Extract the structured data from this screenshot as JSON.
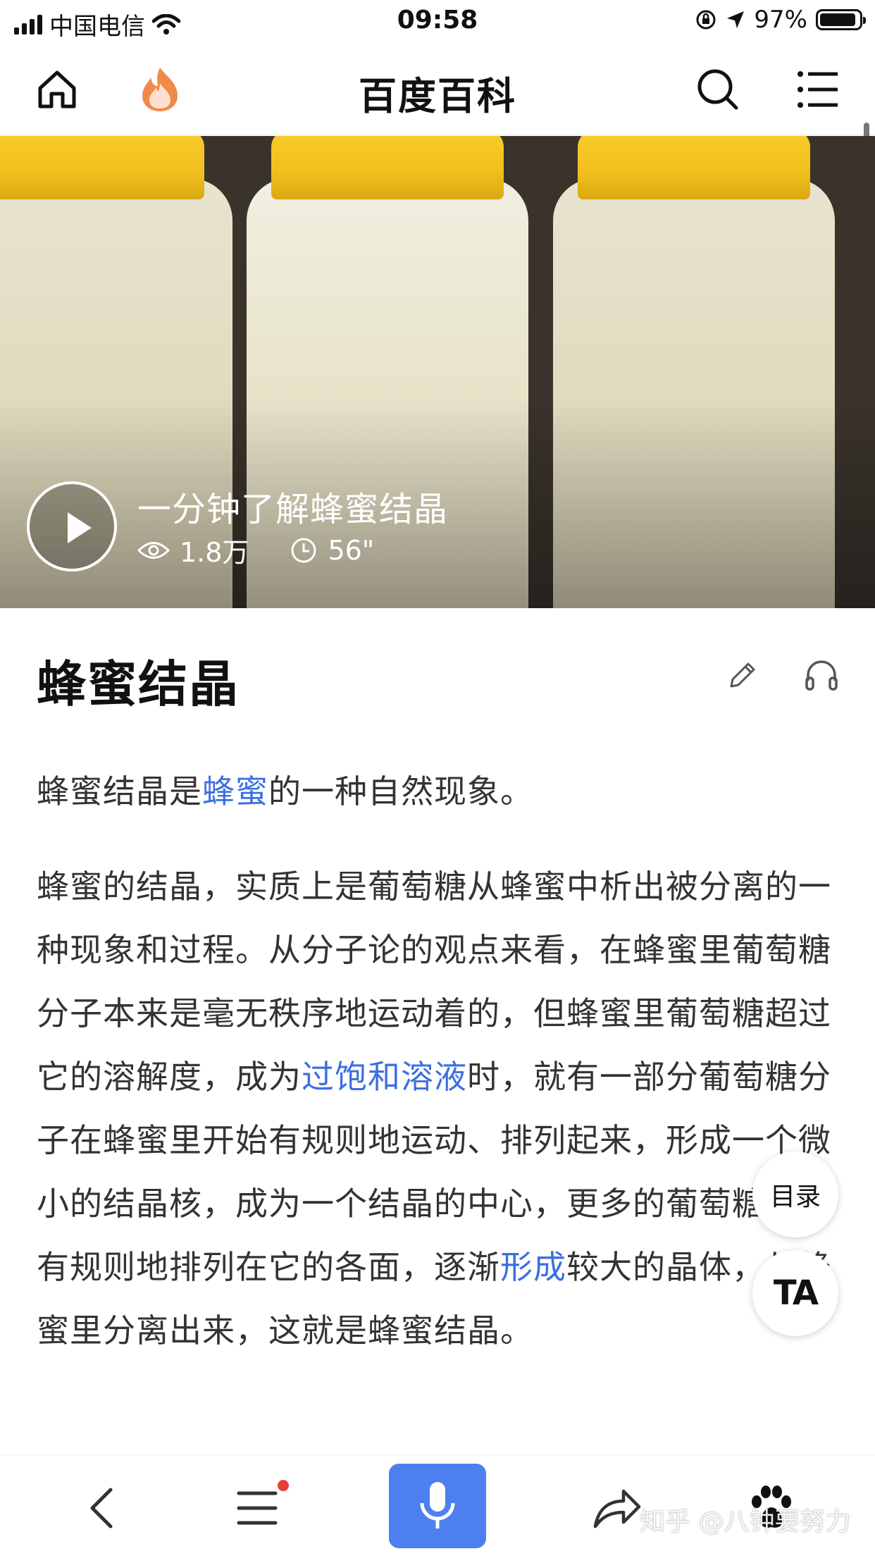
{
  "status_bar": {
    "carrier": "中国电信",
    "time": "09:58",
    "battery": "97%",
    "battery_level": 0.97
  },
  "navbar": {
    "title": "百度百科"
  },
  "video": {
    "title": "一分钟了解蜂蜜结晶",
    "views": "1.8万",
    "duration": "56\""
  },
  "article": {
    "title": "蜂蜜结晶",
    "intro": {
      "before": "蜂蜜结晶是",
      "link": "蜂蜜",
      "after": "的一种自然现象。"
    },
    "body": {
      "part1": "蜂蜜的结晶，实质上是葡萄糖从蜂蜜中析出被分离的一种现象和过程。从分子论的观点来看，在蜂蜜里葡萄糖分子本来是毫无秩序地运动着的，但蜂蜜里葡萄糖超过它的溶解度，成为",
      "link1": "过饱和溶液",
      "part2": "时，就有一部分葡萄糖分子在蜂蜜里开始有规则地运动、排列起来，形成一个微小的结晶核，成为一个结晶的中心，更多的葡萄糖分子有规则地排列在它的各面，逐渐",
      "link2": "形成",
      "part3": "较大的晶体，从蜂蜜里分离出来，这就是蜂蜜结晶。"
    }
  },
  "floating": {
    "toc": "目录",
    "ta": "TA"
  },
  "watermark": "知乎 @八钟要努力",
  "colors": {
    "link": "#3c6fe0",
    "mic_button": "#4e7ff0",
    "hot_icon": "#f08a4b",
    "cap_yellow": "#f2c01e",
    "notification": "#ea3e35"
  }
}
